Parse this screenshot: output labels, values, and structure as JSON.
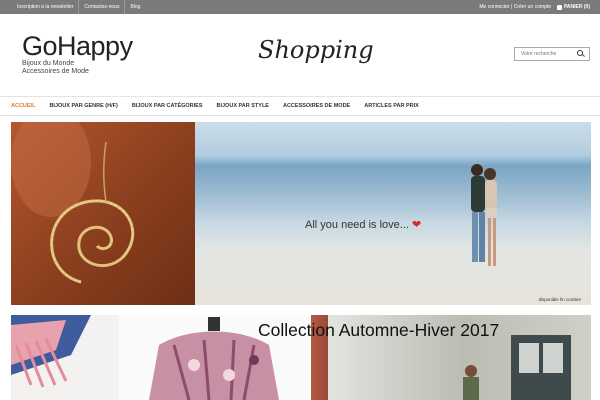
{
  "topbar": {
    "links": [
      "Inscription à la newsletter",
      "Contactez-nous",
      "Blog"
    ],
    "account": "Me connecter | Créer un compte",
    "cart": "PANIER (0)"
  },
  "header": {
    "brand": "GoHappy",
    "tagline1": "Bijoux du Monde",
    "tagline2": "Accessoires de Mode",
    "shopping": "Shopping",
    "search_placeholder": "Votre recherche"
  },
  "nav": {
    "items": [
      "ACCUEIL",
      "BIJOUX PAR GENRE (H/F)",
      "BIJOUX PAR CATÉGORIES",
      "BIJOUX PAR STYLE",
      "ACCESSOIRES DE MODE",
      "ARTICLES PAR PRIX"
    ],
    "active": "ACCUEIL"
  },
  "hero": {
    "caption": "All you need is love...",
    "badge": "disponible fin octobre"
  },
  "collection": {
    "title": "Collection Automne-Hiver 2017"
  },
  "colors": {
    "accent": "#e87722",
    "topbar": "#7a7a7a",
    "heart": "#d9252b"
  },
  "icons": [
    "shopping-bag-icon",
    "search-icon",
    "heart-icon"
  ]
}
